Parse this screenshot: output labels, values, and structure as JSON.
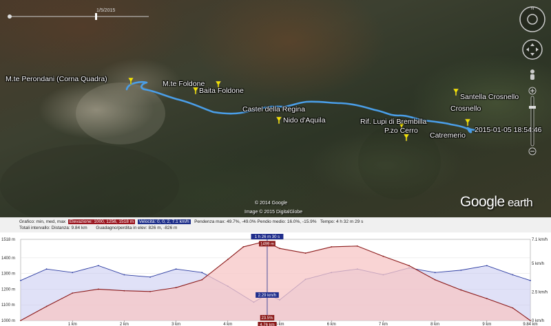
{
  "map": {
    "date_label": "1/5/2015",
    "places": [
      {
        "label": "M.te Perondani (Corna Quadra)",
        "pin": true
      },
      {
        "label": "M.te Foldone",
        "pin": true
      },
      {
        "label": "Baita Foldone",
        "pin": true
      },
      {
        "label": "Castel della Regina",
        "pin": false
      },
      {
        "label": "Nido d'Aquila",
        "pin": true
      },
      {
        "label": "Rif. Lupi di Brembilla",
        "pin": true
      },
      {
        "label": "P.zo Cerro",
        "pin": true
      },
      {
        "label": "Santella Crosnello",
        "pin": true
      },
      {
        "label": "Crosnello",
        "pin": false
      },
      {
        "label": "Catremerio",
        "pin": false
      },
      {
        "label": "2015-01-05 18:54:46",
        "pin": false
      }
    ],
    "copyright_1": "© 2014 Google",
    "copyright_2": "Image © 2015 DigitalGlobe",
    "logo_main": "Google",
    "logo_sub": " earth",
    "route_color": "#4a9ee8",
    "pin_color": "#f4e300"
  },
  "profile": {
    "row1": {
      "graph_label": "Grafico: min, med, max",
      "elevation": "Elevazione: 1000, 1256, 1518 m",
      "speed": "Velocità: 0, 0, 2, 7.1 km/h",
      "slope": "Pendenza max: 49.7%, -49.0%  Pendio medio: 16.0%, -15.9%",
      "time": "Tempo: 4 h 32 m 29 s"
    },
    "row2": {
      "totals": "Totali intervallo:  Distanza: 9.84 km",
      "gain_loss": "Guadagno/perdita in elev: 826 m, -826 m"
    },
    "y_left_labels": [
      "1518 m",
      "1400 m",
      "1300 m",
      "1200 m",
      "1100 m",
      "1000 m"
    ],
    "y_right_labels": [
      "7.1 km/h",
      "5 km/h",
      "2.5 km/h",
      "0 km/h"
    ],
    "x_labels": [
      "1 km",
      "2 km",
      "3 km",
      "4 km",
      "5 km",
      "6 km",
      "7 km",
      "8 km",
      "9 km",
      "9.84 km"
    ],
    "cursor_distance": "4.76 km",
    "cursor_time": "1 h 26 m 30 s",
    "cursor_elevation": "1499 m",
    "cursor_speed": "2.29 km/h",
    "cursor_slope": "23.5%",
    "colors": {
      "elevation_fill": "#f7c6c6",
      "elevation_line": "#8a1818",
      "speed_fill": "#c6c8f0",
      "speed_line": "#2a3aa0",
      "cursor": "#1f2d8c"
    }
  },
  "chart_data": {
    "type": "area",
    "xlabel": "",
    "ylabel": "",
    "x_range_km": [
      0,
      9.84
    ],
    "series": [
      {
        "name": "Elevazione",
        "unit": "m",
        "x": [
          0,
          0.5,
          1.0,
          1.5,
          2.0,
          2.5,
          3.0,
          3.5,
          4.0,
          4.3,
          4.6,
          4.76,
          5.0,
          5.5,
          6.0,
          6.5,
          7.0,
          7.5,
          8.0,
          8.5,
          9.0,
          9.5,
          9.84
        ],
        "values": [
          1000,
          1090,
          1175,
          1200,
          1190,
          1185,
          1210,
          1260,
          1390,
          1470,
          1495,
          1499,
          1460,
          1430,
          1470,
          1475,
          1410,
          1350,
          1260,
          1195,
          1140,
          1080,
          1000
        ]
      },
      {
        "name": "Velocità",
        "unit": "km/h",
        "x": [
          0,
          0.5,
          1.0,
          1.5,
          2.0,
          2.5,
          3.0,
          3.5,
          4.0,
          4.5,
          4.76,
          5.0,
          5.5,
          6.0,
          6.5,
          7.0,
          7.5,
          8.0,
          8.5,
          9.0,
          9.5,
          9.84
        ],
        "values": [
          3.5,
          4.5,
          4.2,
          4.8,
          4.0,
          3.8,
          4.5,
          4.2,
          3.0,
          1.6,
          2.29,
          1.8,
          3.6,
          4.2,
          4.5,
          4.0,
          4.6,
          4.2,
          4.4,
          4.8,
          4.0,
          3.5
        ]
      }
    ],
    "elevation_ylim": [
      1000,
      1518
    ],
    "speed_ylim": [
      0,
      7.1
    ]
  }
}
